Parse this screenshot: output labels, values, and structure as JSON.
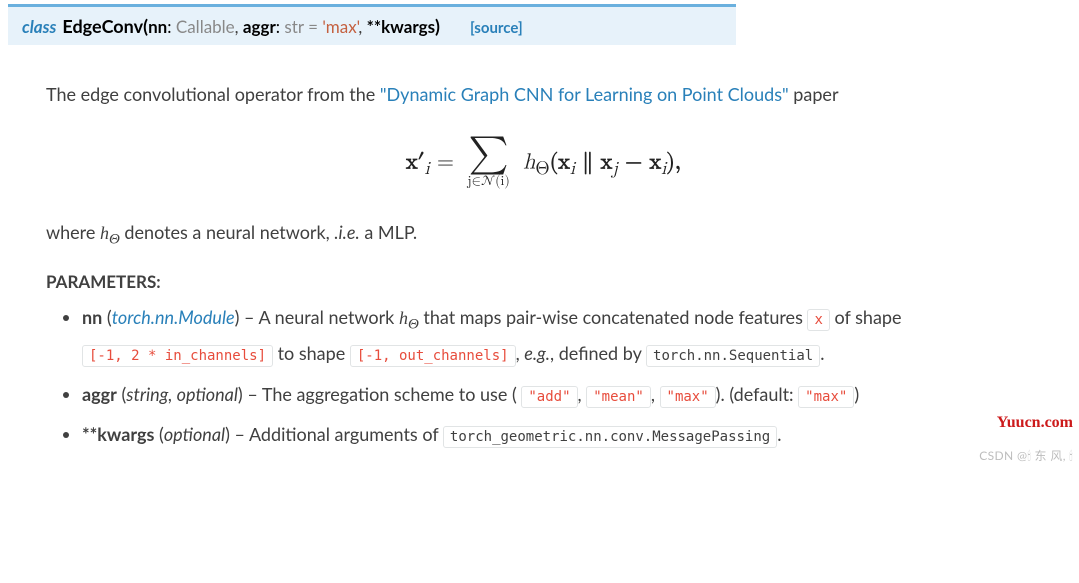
{
  "signature": {
    "keyword": "class",
    "name": "EdgeConv",
    "open": " ( ",
    "close": " )",
    "params": [
      {
        "name": "nn",
        "colon": ":",
        "ann": "Callable",
        "sep": ","
      },
      {
        "name": "aggr",
        "colon": ":",
        "ann": "str",
        "eq": "=",
        "default": "'max'",
        "sep": ","
      },
      {
        "stars": "**",
        "name": "kwargs"
      }
    ],
    "source": "[source]"
  },
  "intro": {
    "before": "The edge convolutional operator from the ",
    "link": "\"Dynamic Graph CNN for Learning on Point Clouds\"",
    "after": " paper"
  },
  "formula": {
    "lhs": "x′",
    "lhs_sub": "i",
    "eq": " = ",
    "sum_symbol": "∑",
    "sum_sub": "j∈𝒩(i)",
    "rhs": "h",
    "theta": "Θ",
    "args": "(x",
    "args_sub1": "i",
    "concat": " ∥ x",
    "args_sub2": "j",
    "minus": " − x",
    "args_sub3": "i",
    "close": "),"
  },
  "where": {
    "before": "where ",
    "h": "h",
    "theta": "Θ",
    "after1": " denotes a neural network, ",
    "ie": ".i.e.",
    "after2": " a MLP."
  },
  "params_heading": "PARAMETERS:",
  "params": {
    "nn": {
      "name": "nn",
      "open": " (",
      "type": "torch.nn.Module",
      "close": ") – ",
      "desc1": "A neural network ",
      "h": "h",
      "theta": "Θ",
      "desc2": " that maps pair-wise concatenated node features ",
      "code_x": "x",
      "desc3": " of shape ",
      "code_shape1": "[-1, 2 * in_channels]",
      "desc4": " to shape ",
      "code_shape2": "[-1, out_channels]",
      "desc5": ", ",
      "eg": "e.g.",
      "desc6": ", defined by ",
      "code_seq": "torch.nn.Sequential",
      "desc7": "."
    },
    "aggr": {
      "name": "aggr",
      "open": " (",
      "type": "string",
      "sep_t": ", ",
      "opt": "optional",
      "close": ") – ",
      "desc1": "The aggregation scheme to use (",
      "code_add": "\"add\"",
      "sep1": ", ",
      "code_mean": "\"mean\"",
      "sep2": ", ",
      "code_max": "\"max\"",
      "desc2": "). (default: ",
      "code_def": "\"max\"",
      "desc3": ")"
    },
    "kwargs": {
      "name": "**kwargs",
      "open": " (",
      "opt": "optional",
      "close": ") – ",
      "desc1": "Additional arguments of ",
      "code_mp": "torch_geometric.nn.conv.MessagePassing",
      "desc2": "."
    }
  },
  "watermarks": {
    "w1": "Yuucn.com",
    "w2": "CSDN @🕯 东 风, 🕯"
  }
}
